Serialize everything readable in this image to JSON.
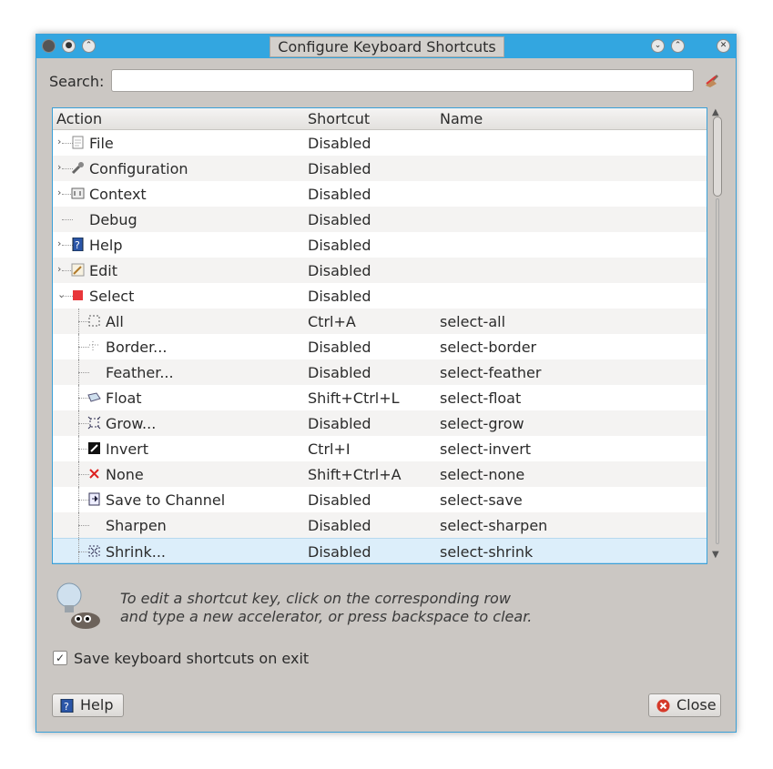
{
  "window": {
    "title": "Configure Keyboard Shortcuts",
    "search_label": "Search:",
    "search_value": ""
  },
  "columns": [
    "Action",
    "Shortcut",
    "Name"
  ],
  "rows": [
    {
      "action": "File",
      "shortcut": "Disabled",
      "name": "",
      "icon": "file-icon",
      "level": 0,
      "expander": "›"
    },
    {
      "action": "Configuration",
      "shortcut": "Disabled",
      "name": "",
      "icon": "wrench-icon",
      "level": 0,
      "expander": "›"
    },
    {
      "action": "Context",
      "shortcut": "Disabled",
      "name": "",
      "icon": "context-icon",
      "level": 0,
      "expander": "›"
    },
    {
      "action": "Debug",
      "shortcut": "Disabled",
      "name": "",
      "icon": "",
      "level": 0,
      "expander": ""
    },
    {
      "action": "Help",
      "shortcut": "Disabled",
      "name": "",
      "icon": "help-icon",
      "level": 0,
      "expander": "›"
    },
    {
      "action": "Edit",
      "shortcut": "Disabled",
      "name": "",
      "icon": "edit-icon",
      "level": 0,
      "expander": "›"
    },
    {
      "action": "Select",
      "shortcut": "Disabled",
      "name": "",
      "icon": "select-icon",
      "level": 0,
      "expander": "⌄"
    },
    {
      "action": "All",
      "shortcut": "Ctrl+A",
      "name": "select-all",
      "icon": "select-all-icon",
      "level": 1
    },
    {
      "action": "Border...",
      "shortcut": "Disabled",
      "name": "select-border",
      "icon": "border-icon",
      "level": 1
    },
    {
      "action": "Feather...",
      "shortcut": "Disabled",
      "name": "select-feather",
      "icon": "",
      "level": 1
    },
    {
      "action": "Float",
      "shortcut": "Shift+Ctrl+L",
      "name": "select-float",
      "icon": "float-icon",
      "level": 1
    },
    {
      "action": "Grow...",
      "shortcut": "Disabled",
      "name": "select-grow",
      "icon": "grow-icon",
      "level": 1
    },
    {
      "action": "Invert",
      "shortcut": "Ctrl+I",
      "name": "select-invert",
      "icon": "invert-icon",
      "level": 1
    },
    {
      "action": "None",
      "shortcut": "Shift+Ctrl+A",
      "name": "select-none",
      "icon": "none-icon",
      "level": 1
    },
    {
      "action": "Save to Channel",
      "shortcut": "Disabled",
      "name": "select-save",
      "icon": "channel-icon",
      "level": 1
    },
    {
      "action": "Sharpen",
      "shortcut": "Disabled",
      "name": "select-sharpen",
      "icon": "",
      "level": 1
    },
    {
      "action": "Shrink...",
      "shortcut": "Disabled",
      "name": "select-shrink",
      "icon": "shrink-icon",
      "level": 1,
      "selected": true
    }
  ],
  "hint": {
    "line1": "To edit a shortcut key, click on the corresponding row",
    "line2": "and type a new accelerator, or press backspace to clear."
  },
  "save_on_exit": {
    "label": "Save keyboard shortcuts on exit",
    "checked": true
  },
  "buttons": {
    "help": "Help",
    "close": "Close"
  }
}
